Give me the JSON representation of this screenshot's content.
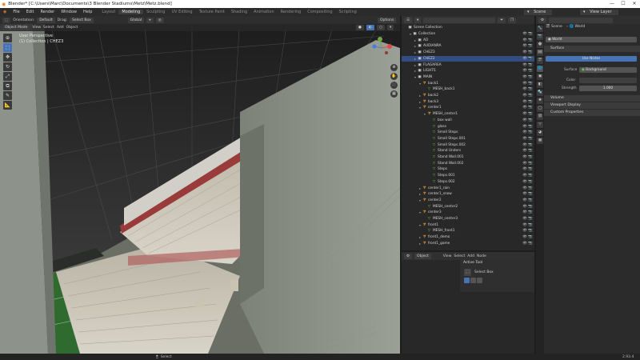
{
  "title_bar": {
    "title": "Blender* [C:\\Users\\Marc\\Documents\\3 Blender Stadiums\\Metz\\Metz.blend]",
    "min": "—",
    "max": "☐",
    "close": "✕"
  },
  "menubar": {
    "menus": [
      "File",
      "Edit",
      "Render",
      "Window",
      "Help"
    ],
    "workspaces": [
      "Layout",
      "Modeling",
      "Sculpting",
      "UV Editing",
      "Texture Paint",
      "Shading",
      "Animation",
      "Rendering",
      "Compositing",
      "Scripting"
    ],
    "active_workspace": "Modeling",
    "scene_label": "Scene",
    "view_layer_label": "View Layer"
  },
  "viewport": {
    "orientation_label": "Orientation:",
    "orientation_value": "Default",
    "drag_label": "Drag:",
    "drag_value": "Select Box",
    "transform_value": "Global",
    "options_label": "Options",
    "mode": "Object Mode",
    "menus": [
      "View",
      "Select",
      "Add",
      "Object"
    ],
    "overlay_line1": "User Perspective",
    "overlay_line2": "(1) Collection | CHEZ3"
  },
  "outliner": {
    "search_placeholder": "",
    "rows": [
      {
        "label": "Scene Collection",
        "indent": 0,
        "type": "coll",
        "arrow": ""
      },
      {
        "label": "Collection",
        "indent": 1,
        "type": "coll",
        "arrow": "▾"
      },
      {
        "label": "AD",
        "indent": 2,
        "type": "coll",
        "arrow": "▸"
      },
      {
        "label": "AUDIANRA",
        "indent": 2,
        "type": "coll",
        "arrow": "▸"
      },
      {
        "label": "CHEZ3",
        "indent": 2,
        "type": "coll",
        "arrow": "▸"
      },
      {
        "label": "CHEZ2",
        "indent": 2,
        "type": "coll",
        "arrow": "▸",
        "selected": true
      },
      {
        "label": "FLAGAREA",
        "indent": 2,
        "type": "coll",
        "arrow": "▸"
      },
      {
        "label": "LIGHTS",
        "indent": 2,
        "type": "coll",
        "arrow": "▸"
      },
      {
        "label": "MAIN",
        "indent": 2,
        "type": "coll",
        "arrow": "▾"
      },
      {
        "label": "back1",
        "indent": 3,
        "type": "mesh",
        "arrow": "▾"
      },
      {
        "label": "MESH_back1",
        "indent": 4,
        "type": "tri",
        "arrow": ""
      },
      {
        "label": "back2",
        "indent": 3,
        "type": "mesh",
        "arrow": "▸"
      },
      {
        "label": "back3",
        "indent": 3,
        "type": "mesh",
        "arrow": "▸"
      },
      {
        "label": "center1",
        "indent": 3,
        "type": "mesh",
        "arrow": "▾"
      },
      {
        "label": "MESH_center1",
        "indent": 4,
        "type": "mesh",
        "arrow": "▾"
      },
      {
        "label": "box wall",
        "indent": 5,
        "type": "tri",
        "arrow": ""
      },
      {
        "label": "glass",
        "indent": 5,
        "type": "tri",
        "arrow": ""
      },
      {
        "label": "Small Steps",
        "indent": 5,
        "type": "tri",
        "arrow": ""
      },
      {
        "label": "Small Steps.001",
        "indent": 5,
        "type": "tri",
        "arrow": ""
      },
      {
        "label": "Small Steps.002",
        "indent": 5,
        "type": "tri",
        "arrow": ""
      },
      {
        "label": "Stand Unders",
        "indent": 5,
        "type": "tri",
        "arrow": ""
      },
      {
        "label": "Stand Wall.001",
        "indent": 5,
        "type": "tri",
        "arrow": ""
      },
      {
        "label": "Stand Wall.002",
        "indent": 5,
        "type": "tri",
        "arrow": ""
      },
      {
        "label": "Steps",
        "indent": 5,
        "type": "tri",
        "arrow": ""
      },
      {
        "label": "Steps.001",
        "indent": 5,
        "type": "tri",
        "arrow": ""
      },
      {
        "label": "Steps.002",
        "indent": 5,
        "type": "tri",
        "arrow": ""
      },
      {
        "label": "center1_rain",
        "indent": 3,
        "type": "mesh",
        "arrow": "▸"
      },
      {
        "label": "center1_snow",
        "indent": 3,
        "type": "mesh",
        "arrow": "▸"
      },
      {
        "label": "center2",
        "indent": 3,
        "type": "mesh",
        "arrow": "▾"
      },
      {
        "label": "MESH_center2",
        "indent": 4,
        "type": "tri",
        "arrow": ""
      },
      {
        "label": "center3",
        "indent": 3,
        "type": "mesh",
        "arrow": "▾"
      },
      {
        "label": "MESH_center3",
        "indent": 4,
        "type": "tri",
        "arrow": ""
      },
      {
        "label": "front1",
        "indent": 3,
        "type": "mesh",
        "arrow": "▾"
      },
      {
        "label": "MESH_front1",
        "indent": 4,
        "type": "tri",
        "arrow": ""
      },
      {
        "label": "front1_demo",
        "indent": 3,
        "type": "mesh",
        "arrow": "▸"
      },
      {
        "label": "front1_game",
        "indent": 3,
        "type": "mesh",
        "arrow": "▸"
      }
    ]
  },
  "tool_panel": {
    "header_items": [
      "Object",
      "View",
      "Select",
      "Add",
      "Node"
    ],
    "active_tool_label": "Active Tool",
    "tool_name": "Select Box"
  },
  "properties": {
    "scene_label": "Scene",
    "world_label": "World",
    "world_name": "World",
    "surface_label": "Surface",
    "use_nodes": "Use Nodes",
    "surface_field_label": "Surface",
    "surface_value": "Background",
    "color_label": "Color",
    "strength_label": "Strength",
    "strength_value": "1.000",
    "volume_label": "Volume",
    "viewport_display_label": "Viewport Display",
    "custom_props_label": "Custom Properties"
  },
  "status": {
    "select_label": "Select",
    "version": "2.93.4"
  }
}
